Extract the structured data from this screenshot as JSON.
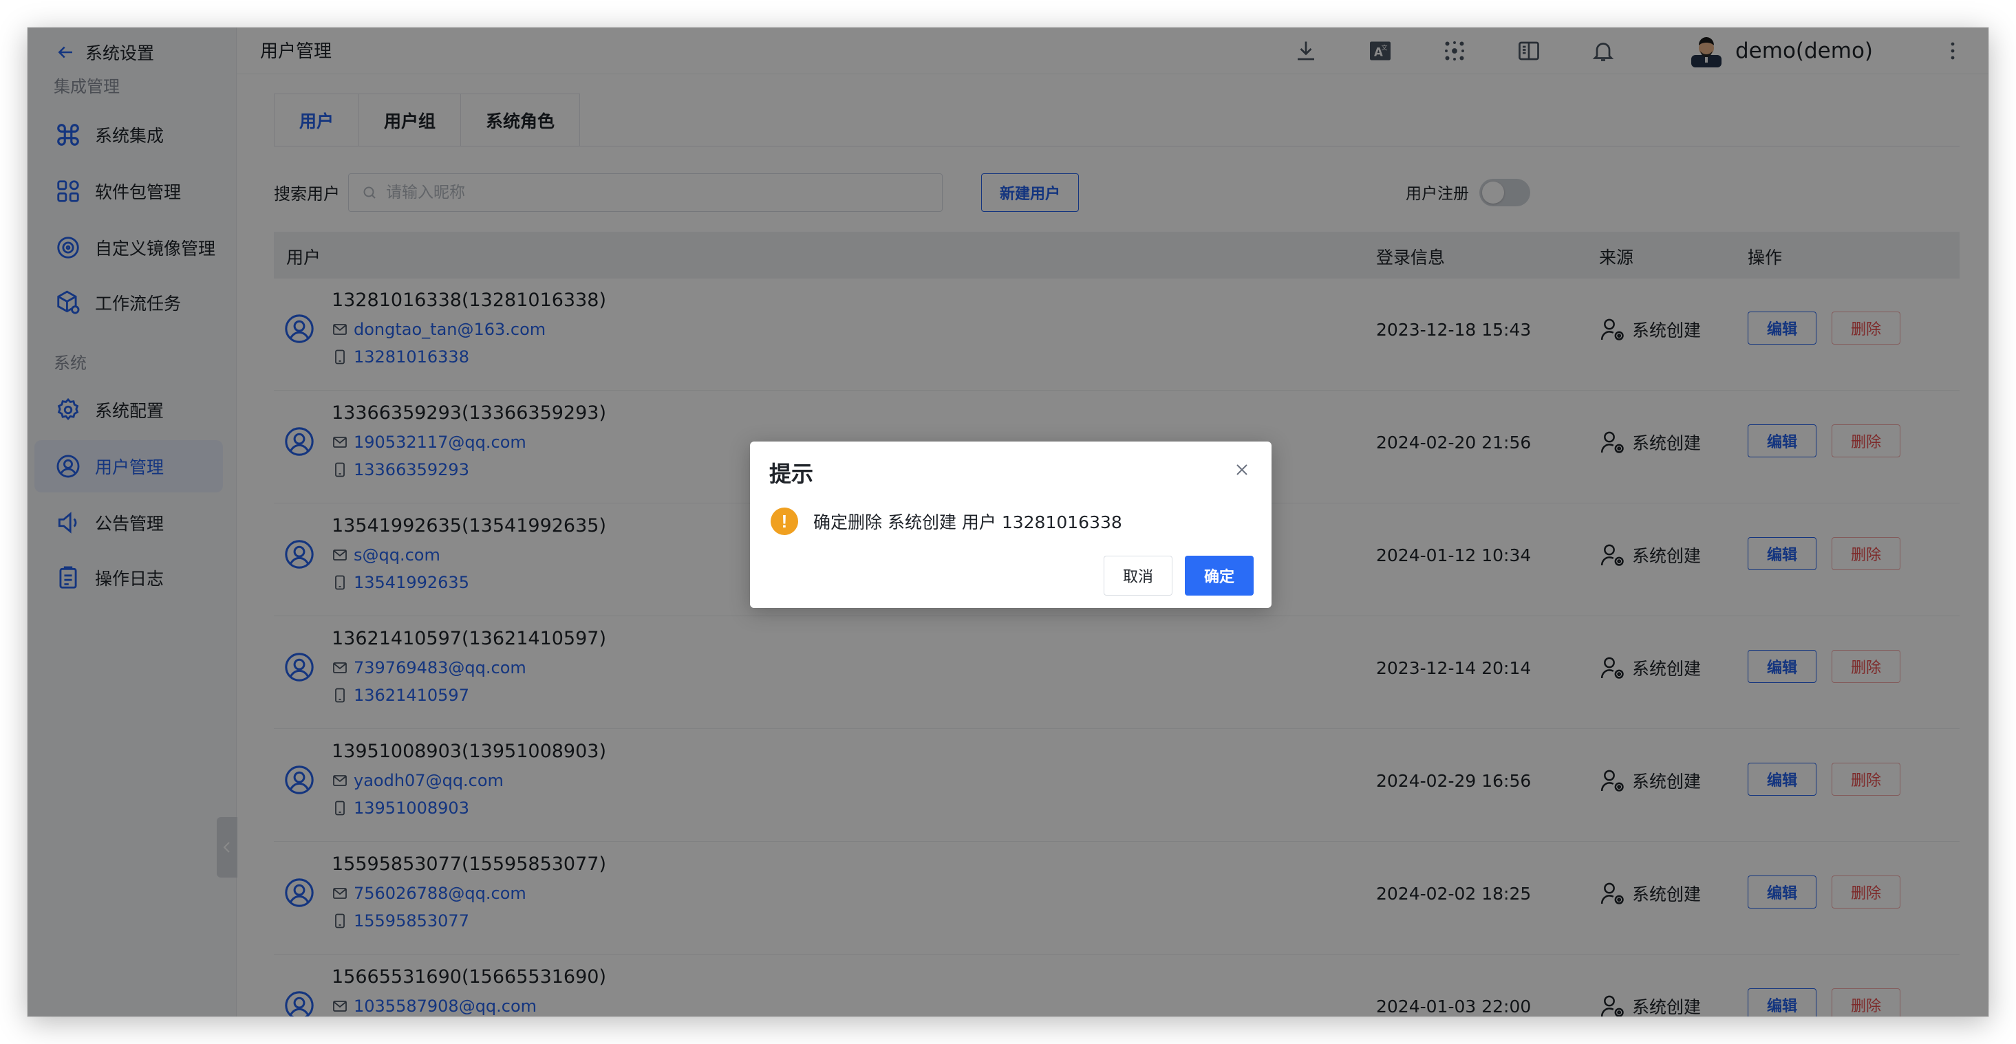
{
  "sidebar": {
    "back_label": "系统设置",
    "section_integration": "集成管理",
    "section_system": "系统",
    "items": [
      {
        "label": "系统集成",
        "icon": "command-icon"
      },
      {
        "label": "软件包管理",
        "icon": "grid-icon"
      },
      {
        "label": "自定义镜像管理",
        "icon": "disc-icon"
      },
      {
        "label": "工作流任务",
        "icon": "cube-gear-icon"
      },
      {
        "label": "系统配置",
        "icon": "gear-icon"
      },
      {
        "label": "用户管理",
        "icon": "user-circle-icon"
      },
      {
        "label": "公告管理",
        "icon": "speaker-icon"
      },
      {
        "label": "操作日志",
        "icon": "clipboard-icon"
      }
    ],
    "active": "用户管理"
  },
  "header": {
    "page_title": "用户管理",
    "username": "demo(demo)",
    "icons": [
      "download-icon",
      "translate-icon",
      "cluster-icon",
      "book-icon",
      "bell-icon"
    ]
  },
  "tabs": [
    {
      "label": "用户",
      "active": true
    },
    {
      "label": "用户组",
      "active": false
    },
    {
      "label": "系统角色",
      "active": false
    }
  ],
  "search": {
    "label": "搜索用户",
    "placeholder": "请输入昵称",
    "new_button": "新建用户",
    "register_label": "用户注册",
    "register_enabled": false
  },
  "table": {
    "columns": [
      "用户",
      "登录信息",
      "来源",
      "操作"
    ],
    "rows": [
      {
        "name": "13281016338(13281016338)",
        "email": "dongtao_tan@163.com",
        "phone": "13281016338",
        "login": "2023-12-18 15:43",
        "source": "系统创建"
      },
      {
        "name": "13366359293(13366359293)",
        "email": "190532117@qq.com",
        "phone": "13366359293",
        "login": "2024-02-20 21:56",
        "source": "系统创建"
      },
      {
        "name": "13541992635(13541992635)",
        "email": "s@qq.com",
        "phone": "13541992635",
        "login": "2024-01-12 10:34",
        "source": "系统创建"
      },
      {
        "name": "13621410597(13621410597)",
        "email": "739769483@qq.com",
        "phone": "13621410597",
        "login": "2023-12-14 20:14",
        "source": "系统创建"
      },
      {
        "name": "13951008903(13951008903)",
        "email": "yaodh07@qq.com",
        "phone": "13951008903",
        "login": "2024-02-29 16:56",
        "source": "系统创建"
      },
      {
        "name": "15595853077(15595853077)",
        "email": "756026788@qq.com",
        "phone": "15595853077",
        "login": "2024-02-02 18:25",
        "source": "系统创建"
      },
      {
        "name": "15665531690(15665531690)",
        "email": "1035587908@qq.com",
        "phone": "",
        "login": "2024-01-03 22:00",
        "source": "系统创建"
      }
    ],
    "edit_label": "编辑",
    "delete_label": "删除"
  },
  "dialog": {
    "title": "提示",
    "message": "确定删除 系统创建 用户 13281016338",
    "warn_glyph": "!",
    "cancel": "取消",
    "ok": "确定"
  },
  "colors": {
    "accent": "#2563eb",
    "danger": "#e84e4e",
    "warning": "#f0a020",
    "mask": "rgba(0,0,0,0.46)"
  }
}
